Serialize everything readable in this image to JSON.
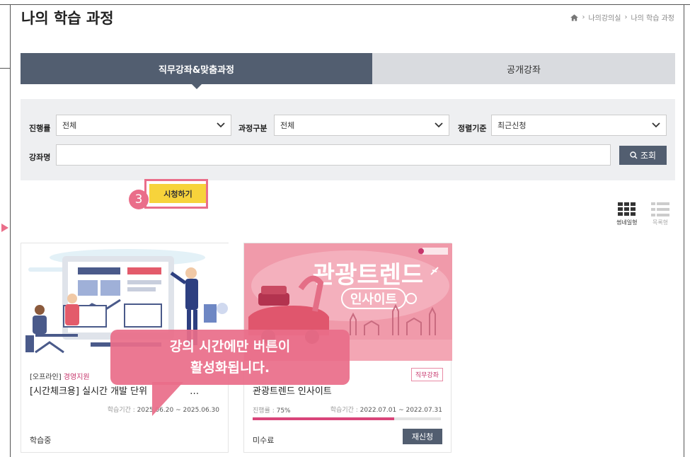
{
  "page": {
    "title": "나의 학습 과정"
  },
  "breadcrumb": {
    "items": [
      "나의강의실",
      "나의 학습 과정"
    ]
  },
  "tabs": [
    {
      "label": "직무강좌&맞춤과정",
      "active": true
    },
    {
      "label": "공개강좌",
      "active": false
    }
  ],
  "filter": {
    "progress_label": "진행률",
    "progress_value": "전체",
    "type_label": "과정구분",
    "type_value": "전체",
    "sort_label": "정렬기준",
    "sort_value": "최근신청",
    "course_name_label": "강좌명",
    "course_name_value": "",
    "search_label": "조회"
  },
  "view": {
    "thumbnail_label": "썸네일형",
    "list_label": "목록형"
  },
  "cards": [
    {
      "category": "[오프라인]",
      "department": "경영지원",
      "title": "[시간체크용] 실시간 개발 단위",
      "title_suffix": "…",
      "period_label": "학습기간 :",
      "period": "2025.06.20 ~ 2025.06.30",
      "status": "학습중",
      "action_label": "시청하기"
    },
    {
      "badge": "직무강좌",
      "title": "관광트렌드 인사이트",
      "progress_label": "진행률 :",
      "progress": "75%",
      "progress_fraction": 0.75,
      "period_label": "학습기간 :",
      "period": "2022.07.01 ~ 2022.07.31",
      "status": "미수료",
      "action_label": "재신청",
      "image_title_line1": "관광트렌드",
      "image_title_line2": "인사이트"
    }
  ],
  "annotation": {
    "step": "3",
    "line1": "강의 시간에만 버튼이",
    "line2": "활성화됩니다."
  },
  "colors": {
    "tab_active": "#525e70",
    "tab_inactive": "#d9dbdf",
    "accent_pink": "#ea6e8a",
    "watch_button": "#f7d33b"
  }
}
